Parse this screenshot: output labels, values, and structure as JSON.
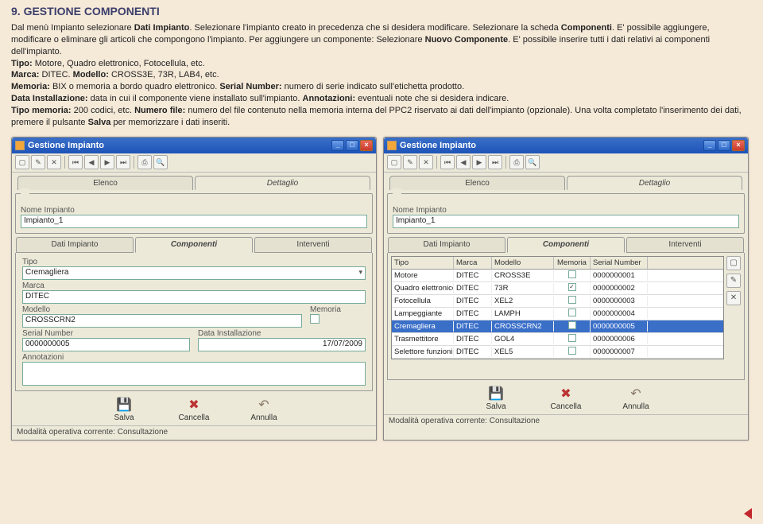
{
  "section": {
    "number": "9.",
    "title": "GESTIONE COMPONENTI"
  },
  "paragraph": {
    "p1a": "Dal menù Impianto selezionare ",
    "p1b": "Dati Impianto",
    "p1c": ". Selezionare l'impianto creato in precedenza che si desidera modificare. Selezionare la scheda ",
    "p1d": "Componenti",
    "p1e": ". E' possibile aggiungere, modificare o eliminare gli articoli che compongono l'impianto. Per aggiungere un componente: Selezionare ",
    "p1f": "Nuovo Componente",
    "p1g": ". E' possibile inserire tutti i dati relativi ai componenti dell'impianto.",
    "tipo_l": "Tipo: ",
    "tipo_v": "Motore, Quadro elettronico, Fotocellula, etc.",
    "marca_l": "Marca: ",
    "marca_v": "DITEC. ",
    "modello_l": "Modello: ",
    "modello_v": "CROSS3E, 73R, LAB4, etc.",
    "mem_l": "Memoria: ",
    "mem_v": "BIX o memoria a bordo quadro elettronico. ",
    "sn_l": "Serial Number: ",
    "sn_v": "numero di serie indicato sull'etichetta prodotto.",
    "di_l": "Data Installazione: ",
    "di_v": "data in cui il componente viene installato sull'impianto. ",
    "ann_l": "Annotazioni: ",
    "ann_v": "eventuali note che si desidera indicare.",
    "tm_l": "Tipo memoria: ",
    "tm_v": "200 codici, etc. ",
    "nf_l": "Numero file: ",
    "nf_v": "numero del file contenuto nella memoria interna del PPC2 riservato ai dati dell'impianto (opzionale). Una volta completato l'inserimento dei dati, premere il pulsante ",
    "nf_s": "Salva",
    "nf_e": " per memorizzare i dati inseriti."
  },
  "win": {
    "title": "Gestione Impianto",
    "tabs": {
      "elenco": "Elenco",
      "dettaglio": "Dettaglio"
    },
    "nome_lbl": "Nome Impianto",
    "nome_val": "Impianto_1",
    "tabs2": {
      "dati": "Dati Impianto",
      "comp": "Componenti",
      "int": "Interventi"
    },
    "form": {
      "tipo_l": "Tipo",
      "tipo_v": "Cremagliera",
      "marca_l": "Marca",
      "marca_v": "DITEC",
      "modello_l": "Modello",
      "modello_v": "CROSSCRN2",
      "mem_l": "Memoria",
      "sn_l": "Serial Number",
      "sn_v": "0000000005",
      "di_l": "Data Installazione",
      "di_v": "17/07/2009",
      "ann_l": "Annotazioni"
    },
    "btns": {
      "save": "Salva",
      "del": "Cancella",
      "undo": "Annulla"
    },
    "status": "Modalità operativa corrente: Consultazione",
    "grid": {
      "h_tipo": "Tipo",
      "h_marca": "Marca",
      "h_mod": "Modello",
      "h_mem": "Memoria",
      "h_sn": "Serial Number",
      "rows": [
        {
          "tipo": "Motore",
          "marca": "DITEC",
          "mod": "CROSS3E",
          "mem": false,
          "sn": "0000000001"
        },
        {
          "tipo": "Quadro elettronico",
          "marca": "DITEC",
          "mod": "73R",
          "mem": true,
          "sn": "0000000002"
        },
        {
          "tipo": "Fotocellula",
          "marca": "DITEC",
          "mod": "XEL2",
          "mem": false,
          "sn": "0000000003"
        },
        {
          "tipo": "Lampeggiante",
          "marca": "DITEC",
          "mod": "LAMPH",
          "mem": false,
          "sn": "0000000004"
        },
        {
          "tipo": "Cremagliera",
          "marca": "DITEC",
          "mod": "CROSSCRN2",
          "mem": false,
          "sn": "0000000005"
        },
        {
          "tipo": "Trasmettitore",
          "marca": "DITEC",
          "mod": "GOL4",
          "mem": false,
          "sn": "0000000006"
        },
        {
          "tipo": "Selettore funzioni",
          "marca": "DITEC",
          "mod": "XEL5",
          "mem": false,
          "sn": "0000000007"
        }
      ]
    }
  }
}
